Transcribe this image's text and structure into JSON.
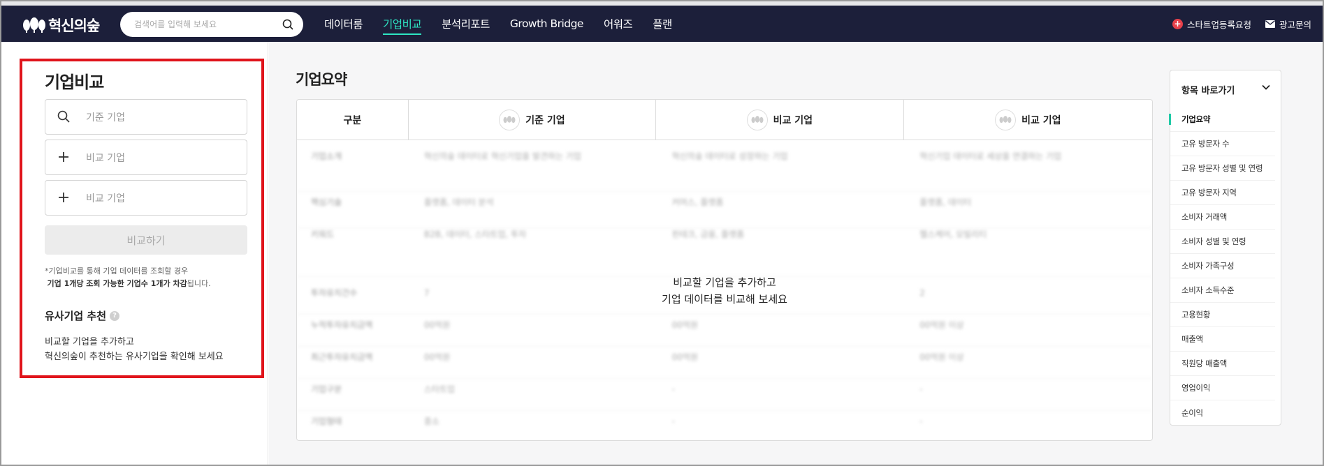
{
  "header": {
    "logo_text": "혁신의숲",
    "search_placeholder": "검색어를 입력해 보세요",
    "nav": [
      "데이터룸",
      "기업비교",
      "분석리포트",
      "Growth Bridge",
      "어워즈",
      "플랜"
    ],
    "active_nav": "기업비교",
    "startup_request": "스타트업등록요청",
    "ad_inquiry": "광고문의"
  },
  "left": {
    "title": "기업비교",
    "base_placeholder": "기준 기업",
    "compare_placeholder_1": "비교 기업",
    "compare_placeholder_2": "비교 기업",
    "compare_button": "비교하기",
    "notice_line1": "*기업비교를 통해 기업 데이터를 조회할 경우",
    "notice_bold": "기업 1개당 조회 가능한 기업수 1개가 차감",
    "notice_tail": "됩니다.",
    "recommend_title": "유사기업 추천",
    "recommend_help": "?",
    "recommend_desc_1": "비교할 기업을 추가하고",
    "recommend_desc_2": "혁신의숲이 추천하는 유사기업을 확인해 보세요"
  },
  "main": {
    "title": "기업요약",
    "col_label": "구분",
    "col_base": "기준 기업",
    "col_cmp1": "비교 기업",
    "col_cmp2": "비교 기업",
    "empty_line1": "비교할 기업을 추가하고",
    "empty_line2": "기업 데이터를 비교해 보세요",
    "rows": [
      {
        "label": "기업소개",
        "v1": "혁신의숲 데이터로 혁신기업을 발견하는 기업",
        "v2": "혁신의숲 데이터로 성장하는 기업",
        "v3": "혁신기업 데이터로 세상을 연결하는 기업"
      },
      {
        "label": "핵심기술",
        "v1": "플랫폼, 데이터 분석",
        "v2": "커머스, 플랫폼",
        "v3": "플랫폼, 데이터"
      },
      {
        "label": "키워드",
        "v1": "B2B, 데이터, 스타트업, 투자",
        "v2": "핀테크, 금융, 플랫폼",
        "v3": "헬스케어, 모빌리티"
      },
      {
        "label": "투자유치건수",
        "v1": "7",
        "v2": "",
        "v3": "2"
      },
      {
        "label": "누적투자유치금액",
        "v1": "00억원",
        "v2": "00억원",
        "v3": "00억원 이상"
      },
      {
        "label": "최근투자유치금액",
        "v1": "00억원",
        "v2": "00억원",
        "v3": "00억원 이상"
      },
      {
        "label": "기업구분",
        "v1": "스타트업",
        "v2": "-",
        "v3": "-"
      },
      {
        "label": "기업형태",
        "v1": "중소",
        "v2": "-",
        "v3": "-"
      }
    ]
  },
  "rightnav": {
    "title": "항목 바로가기",
    "items": [
      "기업요약",
      "고유 방문자 수",
      "고유 방문자 성별 및 연령",
      "고유 방문자 지역",
      "소비자 거래액",
      "소비자 성별 및 연령",
      "소비자 가족구성",
      "소비자 소득수준",
      "고용현황",
      "매출액",
      "직원당 매출액",
      "영업이익",
      "순이익"
    ],
    "active": "기업요약"
  },
  "colors": {
    "header_bg": "#1c1f3a",
    "accent": "#2ee6c3",
    "highlight_box": "#e0141b"
  }
}
